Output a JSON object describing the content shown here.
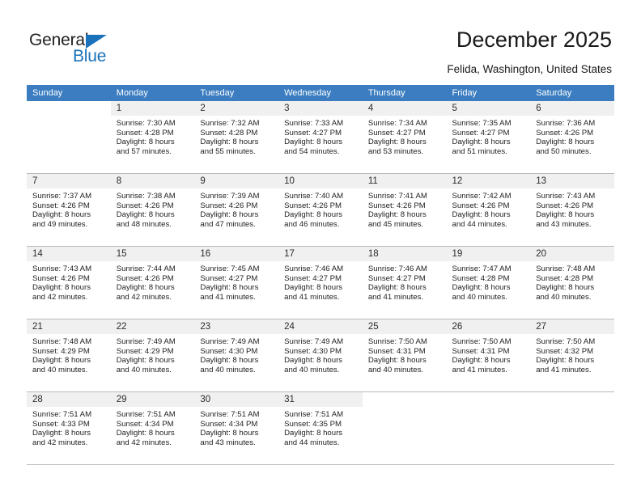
{
  "brand": {
    "name_part1": "General",
    "name_part2": "Blue",
    "triangle_icon": "triangle-icon",
    "accent_color": "#1a72ba"
  },
  "header": {
    "title": "December 2025",
    "subtitle": "Felida, Washington, United States"
  },
  "calendar": {
    "header_bg": "#3b7dc0",
    "daynum_bg": "#f0f0f0",
    "weekdays": [
      "Sunday",
      "Monday",
      "Tuesday",
      "Wednesday",
      "Thursday",
      "Friday",
      "Saturday"
    ],
    "weeks": [
      [
        {
          "day": "",
          "sunrise": "",
          "sunset": "",
          "daylight_line1": "",
          "daylight_line2": ""
        },
        {
          "day": "1",
          "sunrise": "Sunrise: 7:30 AM",
          "sunset": "Sunset: 4:28 PM",
          "daylight_line1": "Daylight: 8 hours",
          "daylight_line2": "and 57 minutes."
        },
        {
          "day": "2",
          "sunrise": "Sunrise: 7:32 AM",
          "sunset": "Sunset: 4:28 PM",
          "daylight_line1": "Daylight: 8 hours",
          "daylight_line2": "and 55 minutes."
        },
        {
          "day": "3",
          "sunrise": "Sunrise: 7:33 AM",
          "sunset": "Sunset: 4:27 PM",
          "daylight_line1": "Daylight: 8 hours",
          "daylight_line2": "and 54 minutes."
        },
        {
          "day": "4",
          "sunrise": "Sunrise: 7:34 AM",
          "sunset": "Sunset: 4:27 PM",
          "daylight_line1": "Daylight: 8 hours",
          "daylight_line2": "and 53 minutes."
        },
        {
          "day": "5",
          "sunrise": "Sunrise: 7:35 AM",
          "sunset": "Sunset: 4:27 PM",
          "daylight_line1": "Daylight: 8 hours",
          "daylight_line2": "and 51 minutes."
        },
        {
          "day": "6",
          "sunrise": "Sunrise: 7:36 AM",
          "sunset": "Sunset: 4:26 PM",
          "daylight_line1": "Daylight: 8 hours",
          "daylight_line2": "and 50 minutes."
        }
      ],
      [
        {
          "day": "7",
          "sunrise": "Sunrise: 7:37 AM",
          "sunset": "Sunset: 4:26 PM",
          "daylight_line1": "Daylight: 8 hours",
          "daylight_line2": "and 49 minutes."
        },
        {
          "day": "8",
          "sunrise": "Sunrise: 7:38 AM",
          "sunset": "Sunset: 4:26 PM",
          "daylight_line1": "Daylight: 8 hours",
          "daylight_line2": "and 48 minutes."
        },
        {
          "day": "9",
          "sunrise": "Sunrise: 7:39 AM",
          "sunset": "Sunset: 4:26 PM",
          "daylight_line1": "Daylight: 8 hours",
          "daylight_line2": "and 47 minutes."
        },
        {
          "day": "10",
          "sunrise": "Sunrise: 7:40 AM",
          "sunset": "Sunset: 4:26 PM",
          "daylight_line1": "Daylight: 8 hours",
          "daylight_line2": "and 46 minutes."
        },
        {
          "day": "11",
          "sunrise": "Sunrise: 7:41 AM",
          "sunset": "Sunset: 4:26 PM",
          "daylight_line1": "Daylight: 8 hours",
          "daylight_line2": "and 45 minutes."
        },
        {
          "day": "12",
          "sunrise": "Sunrise: 7:42 AM",
          "sunset": "Sunset: 4:26 PM",
          "daylight_line1": "Daylight: 8 hours",
          "daylight_line2": "and 44 minutes."
        },
        {
          "day": "13",
          "sunrise": "Sunrise: 7:43 AM",
          "sunset": "Sunset: 4:26 PM",
          "daylight_line1": "Daylight: 8 hours",
          "daylight_line2": "and 43 minutes."
        }
      ],
      [
        {
          "day": "14",
          "sunrise": "Sunrise: 7:43 AM",
          "sunset": "Sunset: 4:26 PM",
          "daylight_line1": "Daylight: 8 hours",
          "daylight_line2": "and 42 minutes."
        },
        {
          "day": "15",
          "sunrise": "Sunrise: 7:44 AM",
          "sunset": "Sunset: 4:26 PM",
          "daylight_line1": "Daylight: 8 hours",
          "daylight_line2": "and 42 minutes."
        },
        {
          "day": "16",
          "sunrise": "Sunrise: 7:45 AM",
          "sunset": "Sunset: 4:27 PM",
          "daylight_line1": "Daylight: 8 hours",
          "daylight_line2": "and 41 minutes."
        },
        {
          "day": "17",
          "sunrise": "Sunrise: 7:46 AM",
          "sunset": "Sunset: 4:27 PM",
          "daylight_line1": "Daylight: 8 hours",
          "daylight_line2": "and 41 minutes."
        },
        {
          "day": "18",
          "sunrise": "Sunrise: 7:46 AM",
          "sunset": "Sunset: 4:27 PM",
          "daylight_line1": "Daylight: 8 hours",
          "daylight_line2": "and 41 minutes."
        },
        {
          "day": "19",
          "sunrise": "Sunrise: 7:47 AM",
          "sunset": "Sunset: 4:28 PM",
          "daylight_line1": "Daylight: 8 hours",
          "daylight_line2": "and 40 minutes."
        },
        {
          "day": "20",
          "sunrise": "Sunrise: 7:48 AM",
          "sunset": "Sunset: 4:28 PM",
          "daylight_line1": "Daylight: 8 hours",
          "daylight_line2": "and 40 minutes."
        }
      ],
      [
        {
          "day": "21",
          "sunrise": "Sunrise: 7:48 AM",
          "sunset": "Sunset: 4:29 PM",
          "daylight_line1": "Daylight: 8 hours",
          "daylight_line2": "and 40 minutes."
        },
        {
          "day": "22",
          "sunrise": "Sunrise: 7:49 AM",
          "sunset": "Sunset: 4:29 PM",
          "daylight_line1": "Daylight: 8 hours",
          "daylight_line2": "and 40 minutes."
        },
        {
          "day": "23",
          "sunrise": "Sunrise: 7:49 AM",
          "sunset": "Sunset: 4:30 PM",
          "daylight_line1": "Daylight: 8 hours",
          "daylight_line2": "and 40 minutes."
        },
        {
          "day": "24",
          "sunrise": "Sunrise: 7:49 AM",
          "sunset": "Sunset: 4:30 PM",
          "daylight_line1": "Daylight: 8 hours",
          "daylight_line2": "and 40 minutes."
        },
        {
          "day": "25",
          "sunrise": "Sunrise: 7:50 AM",
          "sunset": "Sunset: 4:31 PM",
          "daylight_line1": "Daylight: 8 hours",
          "daylight_line2": "and 40 minutes."
        },
        {
          "day": "26",
          "sunrise": "Sunrise: 7:50 AM",
          "sunset": "Sunset: 4:31 PM",
          "daylight_line1": "Daylight: 8 hours",
          "daylight_line2": "and 41 minutes."
        },
        {
          "day": "27",
          "sunrise": "Sunrise: 7:50 AM",
          "sunset": "Sunset: 4:32 PM",
          "daylight_line1": "Daylight: 8 hours",
          "daylight_line2": "and 41 minutes."
        }
      ],
      [
        {
          "day": "28",
          "sunrise": "Sunrise: 7:51 AM",
          "sunset": "Sunset: 4:33 PM",
          "daylight_line1": "Daylight: 8 hours",
          "daylight_line2": "and 42 minutes."
        },
        {
          "day": "29",
          "sunrise": "Sunrise: 7:51 AM",
          "sunset": "Sunset: 4:34 PM",
          "daylight_line1": "Daylight: 8 hours",
          "daylight_line2": "and 42 minutes."
        },
        {
          "day": "30",
          "sunrise": "Sunrise: 7:51 AM",
          "sunset": "Sunset: 4:34 PM",
          "daylight_line1": "Daylight: 8 hours",
          "daylight_line2": "and 43 minutes."
        },
        {
          "day": "31",
          "sunrise": "Sunrise: 7:51 AM",
          "sunset": "Sunset: 4:35 PM",
          "daylight_line1": "Daylight: 8 hours",
          "daylight_line2": "and 44 minutes."
        },
        {
          "day": "",
          "sunrise": "",
          "sunset": "",
          "daylight_line1": "",
          "daylight_line2": ""
        },
        {
          "day": "",
          "sunrise": "",
          "sunset": "",
          "daylight_line1": "",
          "daylight_line2": ""
        },
        {
          "day": "",
          "sunrise": "",
          "sunset": "",
          "daylight_line1": "",
          "daylight_line2": ""
        }
      ]
    ]
  }
}
